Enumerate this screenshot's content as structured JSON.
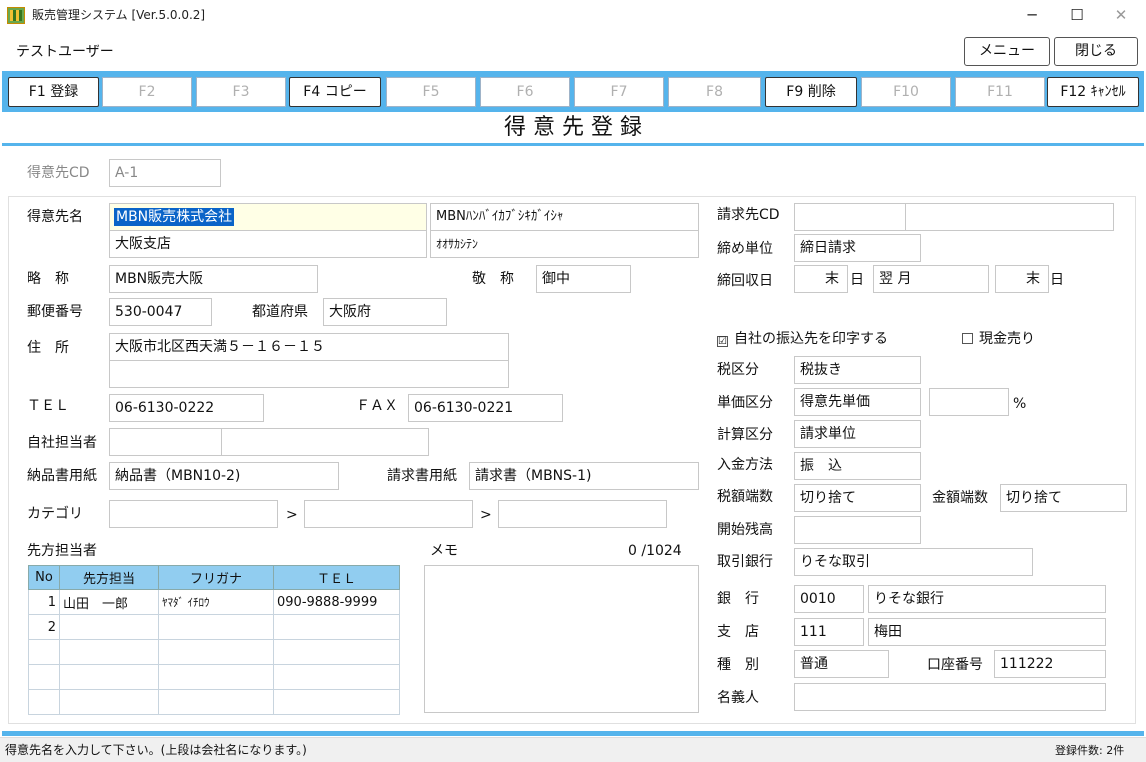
{
  "window": {
    "title": "販売管理システム [Ver.5.0.0.2]"
  },
  "header": {
    "user": "テストユーザー",
    "menu_label": "メニュー",
    "close_label": "閉じる"
  },
  "fkeys": [
    "F1 登録",
    "F2",
    "F3",
    "F4 コピー",
    "F5",
    "F6",
    "F7",
    "F8",
    "F9 削除",
    "F10",
    "F11",
    "F12 ｷｬﾝｾﾙ"
  ],
  "form_title": "得 意 先 登 録",
  "cd": {
    "label": "得意先CD",
    "value": "A-1"
  },
  "name": {
    "label": "得意先名",
    "value": "MBN販売株式会社",
    "kana": "MBNﾊﾝﾊﾞｲｶﾌﾞｼｷｶﾞｲｼｬ",
    "branch": "大阪支店",
    "branch_kana": "ｵｵｻｶｼﾃﾝ"
  },
  "short": {
    "label": "略　称",
    "value": "MBN販売大阪"
  },
  "honorific": {
    "label": "敬　称",
    "value": "御中"
  },
  "postal": {
    "label": "郵便番号",
    "value": "530-0047"
  },
  "pref": {
    "label": "都道府県",
    "value": "大阪府"
  },
  "address": {
    "label": "住　所",
    "line1": "大阪市北区西天満５－１６－１５",
    "line2": ""
  },
  "tel": {
    "label": "ＴＥＬ",
    "value": "06-6130-0222"
  },
  "fax": {
    "label": "ＦＡＸ",
    "value": "06-6130-0221"
  },
  "staff": {
    "label": "自社担当者"
  },
  "delivery_form": {
    "label": "納品書用紙",
    "value": "納品書（MBN10-2)"
  },
  "invoice_form": {
    "label": "請求書用紙",
    "value": "請求書（MBNS-1)"
  },
  "category": {
    "label": "カテゴリ",
    "sep": ">"
  },
  "contacts": {
    "label": "先方担当者",
    "headers": [
      "No",
      "先方担当",
      "フリガナ",
      "ＴＥＬ"
    ],
    "rows": [
      [
        "1",
        "山田　一郎",
        "ﾔﾏﾀﾞ ｲﾁﾛｳ",
        "090-9888-9999"
      ],
      [
        "2",
        "",
        "",
        ""
      ],
      [
        "",
        "",
        "",
        ""
      ],
      [
        "",
        "",
        "",
        ""
      ],
      [
        "",
        "",
        "",
        ""
      ]
    ]
  },
  "memo": {
    "label": "メモ",
    "count": "0 /1024"
  },
  "billing": {
    "cd_label": "請求先CD",
    "closing_unit_label": "締め単位",
    "closing_unit": "締日請求",
    "collection_label": "締回収日",
    "closing_day": "末",
    "day_unit": "日",
    "collection_month": "翌 月",
    "collection_day": "末",
    "print_bank_label": "自社の振込先を印字する",
    "print_bank_check": "☑",
    "cash_label": "現金売り",
    "tax_label": "税区分",
    "tax": "税抜き",
    "price_label": "単価区分",
    "price": "得意先単価",
    "percent": "%",
    "calc_label": "計算区分",
    "calc": "請求単位",
    "payment_label": "入金方法",
    "payment": "振　込",
    "tax_round_label": "税額端数",
    "tax_round": "切り捨て",
    "amount_round_label": "金額端数",
    "amount_round": "切り捨て",
    "opening_label": "開始残高",
    "trade_bank_label": "取引銀行",
    "trade_bank": "りそな取引",
    "bank_label": "銀　行",
    "bank_code": "0010",
    "bank_name": "りそな銀行",
    "branch_label": "支　店",
    "branch_code": "111",
    "branch_name": "梅田",
    "type_label": "種　別",
    "type": "普通",
    "account_label": "口座番号",
    "account": "111222",
    "holder_label": "名義人"
  },
  "status": {
    "message": "得意先名を入力して下さい。(上段は会社名になります。)",
    "count": "登録件数: 2件"
  },
  "colors": {
    "accent": "#55b4ec",
    "header_blue": "#91cdf0",
    "highlight": "#0a64c8",
    "focus_bg": "#ffffe6"
  }
}
